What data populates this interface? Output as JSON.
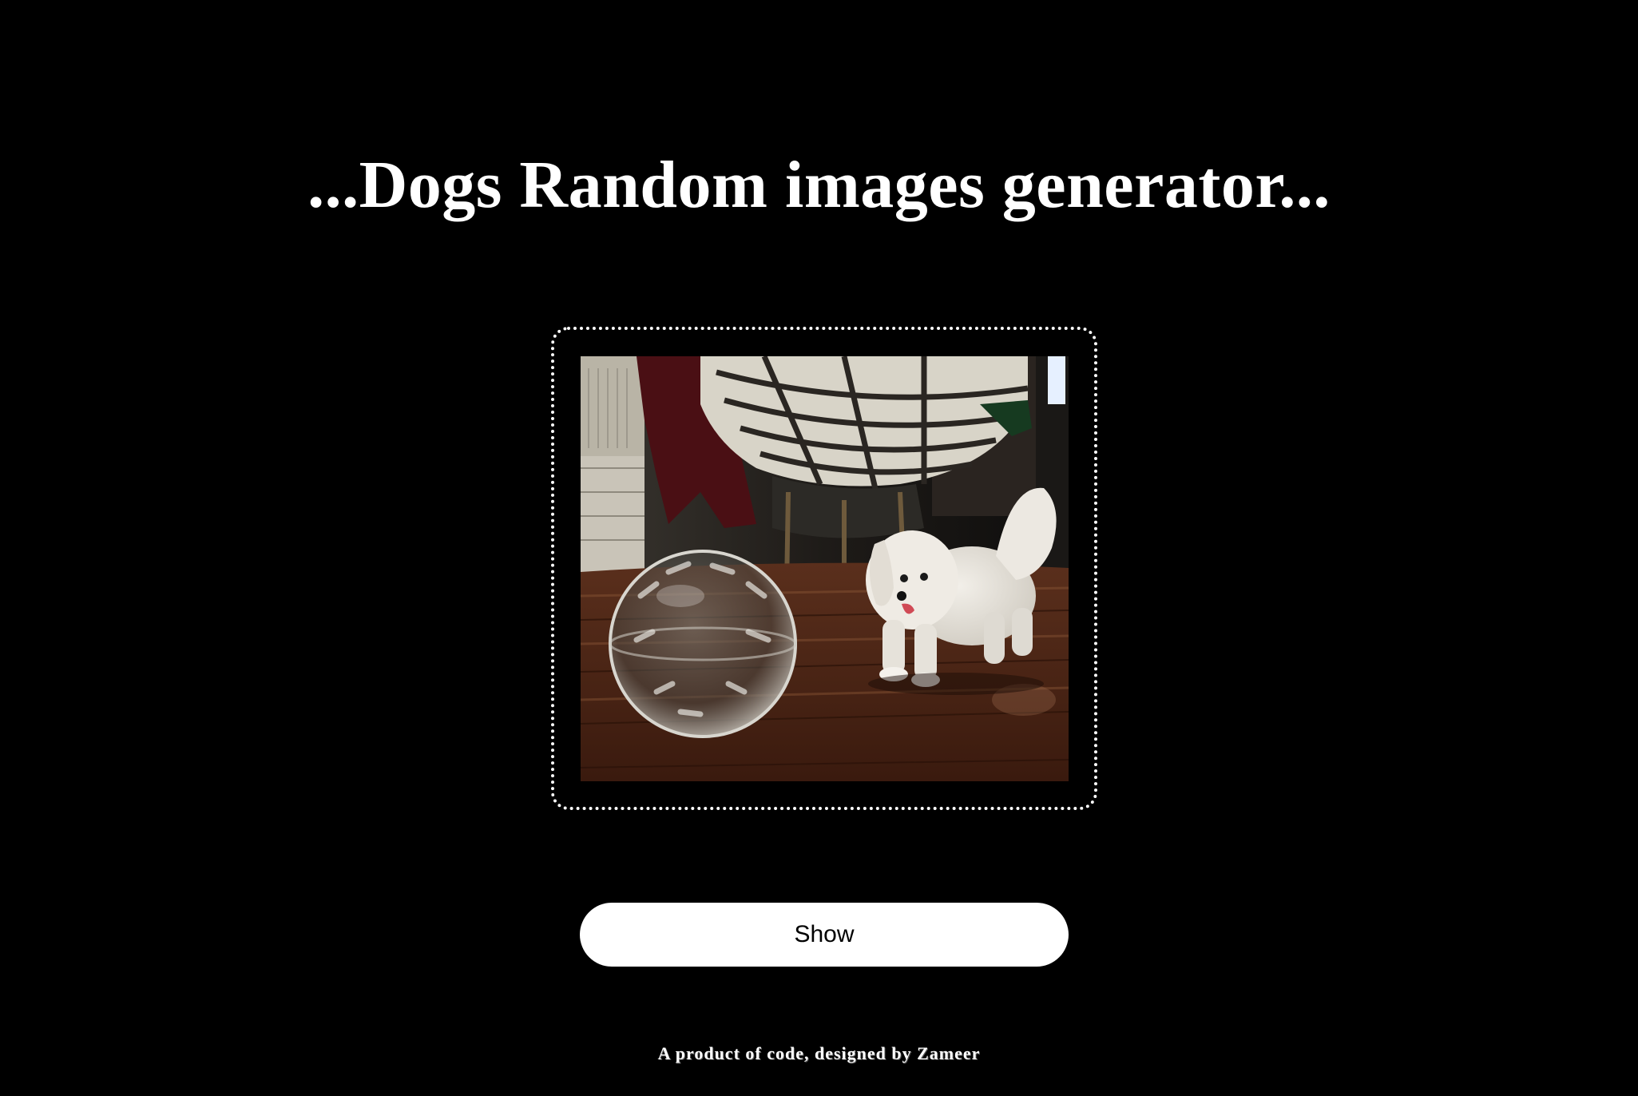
{
  "page": {
    "title": "...Dogs Random images generator...",
    "background_color": "#000000",
    "text_color": "#ffffff"
  },
  "image_panel": {
    "frame_style": "dotted-white-rounded",
    "image_alt": "",
    "image_subject": "white-dog-photo"
  },
  "controls": {
    "show_label": "Show",
    "button_color": "#ffffff",
    "button_text_color": "#000000"
  },
  "footer": {
    "credit": "A product of code, designed by Zameer"
  }
}
